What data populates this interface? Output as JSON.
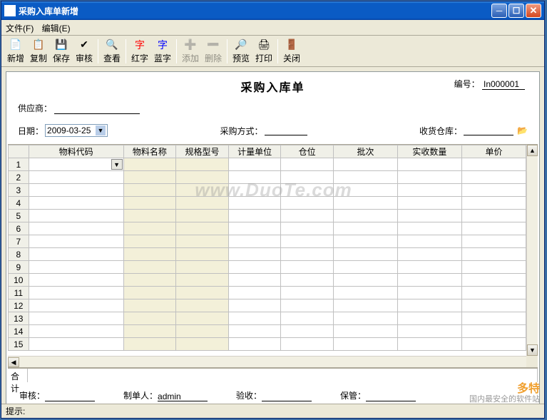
{
  "window": {
    "title": "采购入库单新增"
  },
  "menubar": {
    "file": "文件(F)",
    "edit": "编辑(E)"
  },
  "toolbar": {
    "new": "新增",
    "copy": "复制",
    "save": "保存",
    "audit": "审核",
    "view": "查看",
    "red": "红字",
    "blue": "蓝字",
    "add": "添加",
    "del": "删除",
    "preview": "预览",
    "print": "打印",
    "close": "关闭"
  },
  "doc": {
    "title": "采购入库单",
    "number_label": "编号：",
    "number_value": "In000001",
    "supplier_label": "供应商：",
    "supplier_value": "",
    "date_label": "日期：",
    "date_value": "2009-03-25",
    "purchase_method_label": "采购方式：",
    "purchase_method_value": "",
    "receive_warehouse_label": "收货仓库：",
    "receive_warehouse_value": ""
  },
  "grid": {
    "headers": [
      "物料代码",
      "物料名称",
      "规格型号",
      "计量单位",
      "仓位",
      "批次",
      "实收数量",
      "单价"
    ],
    "row_count": 15,
    "total_label": "合计"
  },
  "signatures": {
    "audit_label": "审核：",
    "audit_value": "",
    "maker_label": "制单人：",
    "maker_value": "admin",
    "inspect_label": "验收：",
    "inspect_value": "",
    "keeper_label": "保管：",
    "keeper_value": ""
  },
  "statusbar": {
    "hint_label": "提示:"
  },
  "watermark": {
    "main": "www.DuoTe.com",
    "corner1": "多特",
    "corner2": "国内最安全的软件站"
  }
}
